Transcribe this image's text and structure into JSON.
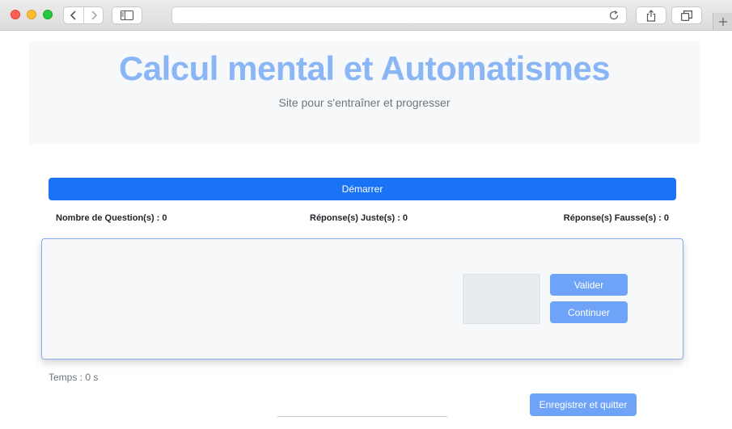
{
  "browser": {
    "url": "",
    "icons": {
      "back": "chevron-left-icon",
      "forward": "chevron-right-icon",
      "sidebar": "sidebar-icon",
      "reload": "reload-icon",
      "share": "share-icon",
      "tabs": "tabs-overview-icon",
      "new_tab": "plus-icon"
    }
  },
  "header": {
    "title": "Calcul mental et Automatismes",
    "subtitle": "Site pour s'entraîner et progresser"
  },
  "controls": {
    "start_label": "Démarrer"
  },
  "stats": {
    "questions": "Nombre de Question(s) : 0",
    "correct": "Réponse(s) Juste(s) : 0",
    "wrong": "Réponse(s) Fausse(s) : 0"
  },
  "card": {
    "answer_value": "",
    "validate_label": "Valider",
    "continue_label": "Continuer"
  },
  "timer": "Temps : 0 s",
  "save_label": "Enregistrer et quitter",
  "colors": {
    "primary": "#1a73f5",
    "primary_disabled": "#6ea3f7",
    "title": "#8ab6f6"
  }
}
